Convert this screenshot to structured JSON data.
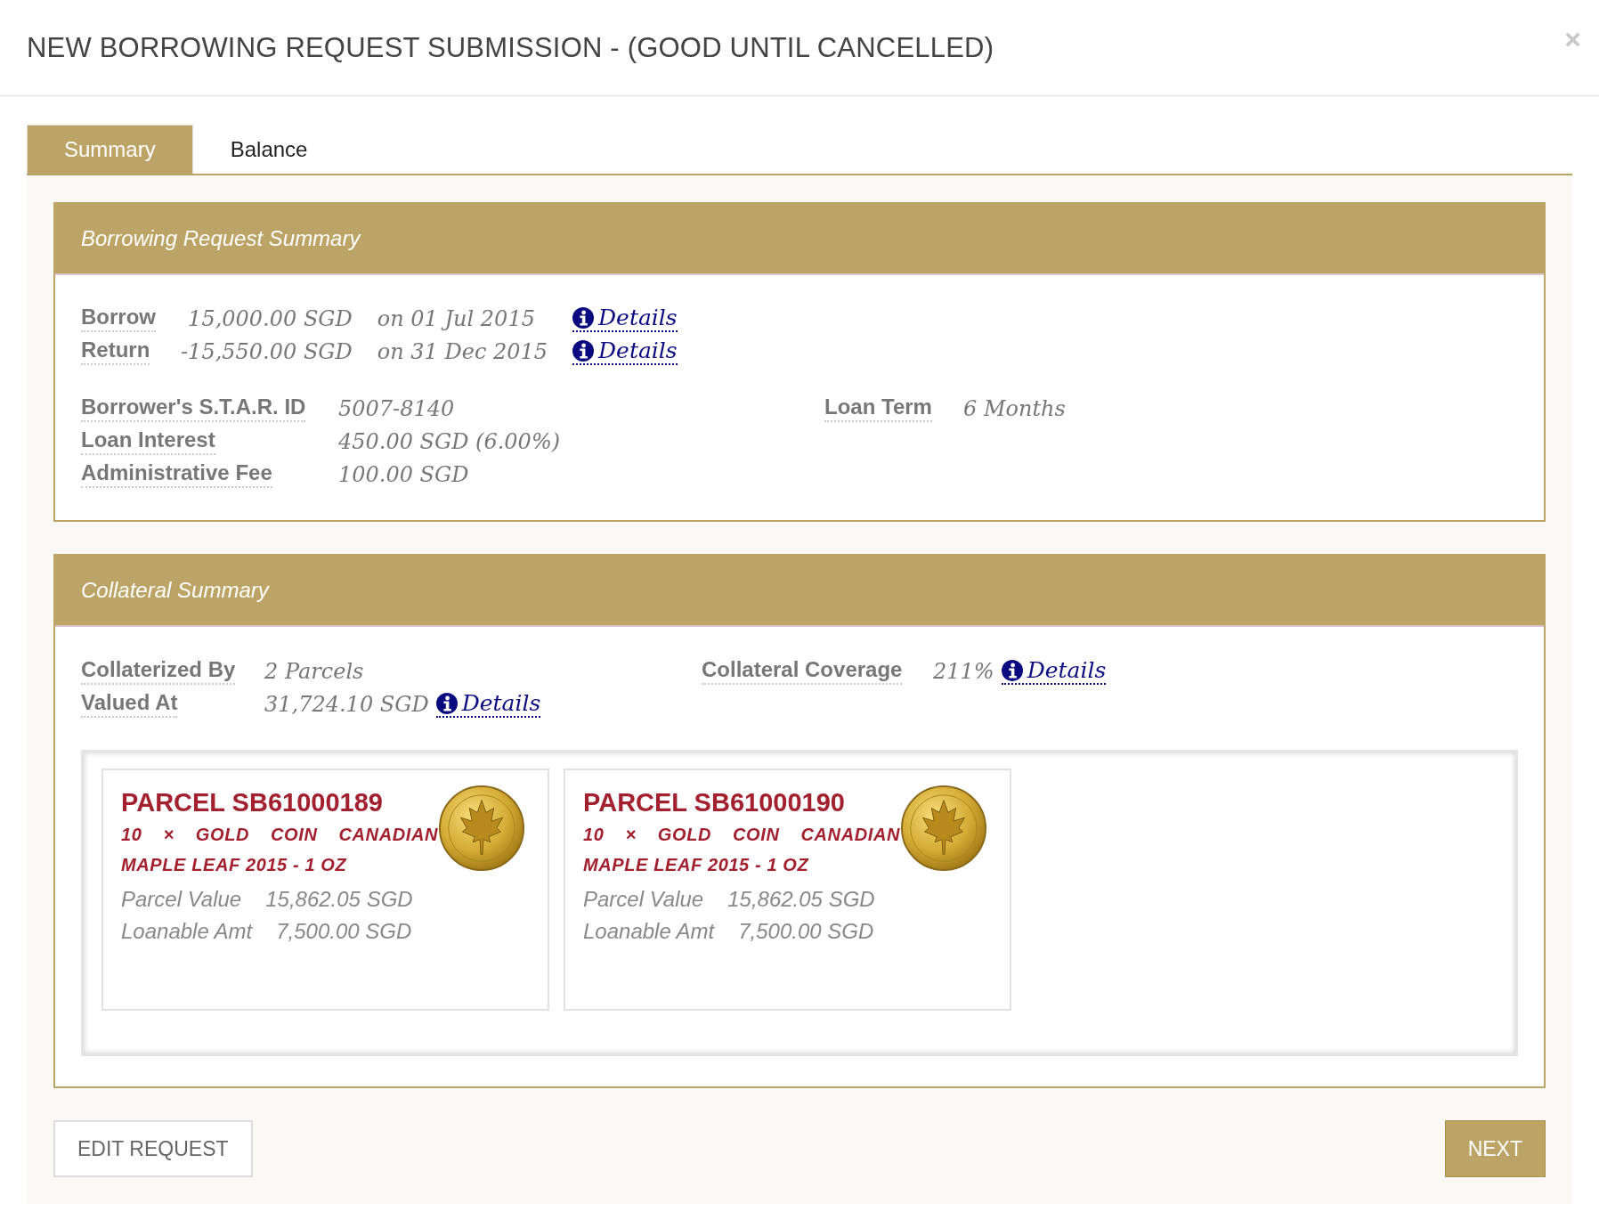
{
  "window": {
    "title": "NEW BORROWING REQUEST SUBMISSION - (GOOD UNTIL CANCELLED)",
    "close": "×"
  },
  "tabs": [
    {
      "label": "Summary",
      "selected": true
    },
    {
      "label": "Balance",
      "selected": false
    }
  ],
  "request_summary": {
    "heading": "Borrowing Request Summary",
    "flows": [
      {
        "label": "Borrow",
        "amount": "15,000.00 SGD",
        "date": "on 01 Jul 2015",
        "link": "Details"
      },
      {
        "label": "Return",
        "amount": "-15,550.00 SGD",
        "date": "on 31 Dec 2015",
        "link": "Details"
      }
    ],
    "left_fields": [
      {
        "label": "Borrower's S.T.A.R. ID",
        "value": "5007-8140"
      },
      {
        "label": "Loan Interest",
        "value": "450.00 SGD (6.00%)"
      },
      {
        "label": "Administrative Fee",
        "value": "100.00 SGD"
      }
    ],
    "right_fields": [
      {
        "label": "Loan Term",
        "value": "6 Months"
      }
    ]
  },
  "collateral_summary": {
    "heading": "Collateral Summary",
    "left_fields": [
      {
        "label": "Collaterized By",
        "value": "2 Parcels"
      },
      {
        "label": "Valued At",
        "value": "31,724.10 SGD",
        "link": "Details"
      }
    ],
    "right_fields": [
      {
        "label": "Collateral Coverage",
        "value": "211%",
        "link": "Details"
      }
    ],
    "parcels": [
      {
        "title": "PARCEL SB61000189",
        "description": "10 × GOLD COIN CANADIAN MAPLE LEAF 2015 - 1 OZ",
        "rows": [
          {
            "label": "Parcel Value",
            "value": "15,862.05 SGD"
          },
          {
            "label": "Loanable Amt",
            "value": "7,500.00 SGD"
          }
        ]
      },
      {
        "title": "PARCEL SB61000190",
        "description": "10 × GOLD COIN CANADIAN MAPLE LEAF 2015 - 1 OZ",
        "rows": [
          {
            "label": "Parcel Value",
            "value": "15,862.05 SGD"
          },
          {
            "label": "Loanable Amt",
            "value": "7,500.00 SGD"
          }
        ]
      }
    ]
  },
  "buttons": [
    {
      "label": "EDIT REQUEST",
      "kind": "secondary"
    },
    {
      "label": "NEXT",
      "kind": "primary"
    }
  ]
}
